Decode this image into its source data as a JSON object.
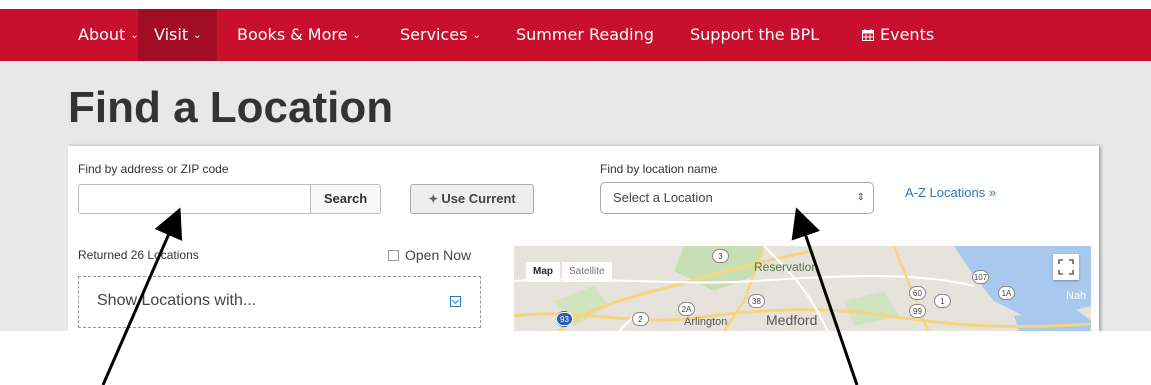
{
  "nav": {
    "items": [
      {
        "label": "About",
        "dropdown": true
      },
      {
        "label": "Visit",
        "dropdown": true,
        "active": true
      },
      {
        "label": "Books & More",
        "dropdown": true
      },
      {
        "label": "Services",
        "dropdown": true
      },
      {
        "label": "Summer Reading",
        "dropdown": false
      },
      {
        "label": "Support the BPL",
        "dropdown": false
      },
      {
        "label": "Events",
        "dropdown": false,
        "icon": "calendar-icon"
      }
    ],
    "colors": {
      "bar": "#c8102e",
      "active": "#a10d24"
    }
  },
  "page": {
    "title": "Find a Location"
  },
  "search": {
    "address_label": "Find by address or ZIP code",
    "address_value": "",
    "search_button": "Search",
    "use_current_button": "Use Current",
    "location_name_label": "Find by location name",
    "location_select_value": "Select a Location",
    "az_link": "A-Z Locations »"
  },
  "results": {
    "count_text": "Returned 26 Locations",
    "open_now_label": "Open Now",
    "open_now_checked": false,
    "filter_label": "Show Locations with..."
  },
  "map": {
    "map_tab": "Map",
    "satellite_tab": "Satellite",
    "selected_tab": "Map",
    "labels": [
      "Reservation",
      "Arlington",
      "Medford",
      "Nah"
    ],
    "route_shields": [
      "3",
      "107",
      "60",
      "1A",
      "99",
      "1",
      "2A",
      "38",
      "93",
      "2"
    ]
  }
}
